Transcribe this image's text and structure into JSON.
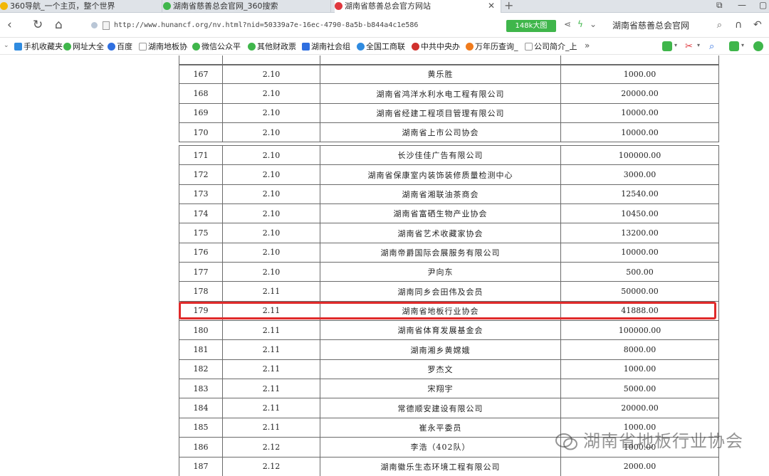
{
  "tabs": [
    {
      "title": "360导航_一个主页，整个世界",
      "icon_color": "#f2b705"
    },
    {
      "title": "湖南省慈善总会官网_360搜索",
      "icon_color": "#3fb64b"
    },
    {
      "title": "湖南省慈善总会官方网站",
      "icon_color": "#e0383e",
      "active": true
    }
  ],
  "address_bar": {
    "url": "http://www.hunancf.org/nv.html?nid=50339a7e-16ec-4790-8a5b-b844a4c1e586",
    "badge": "148k大图",
    "search_text": "湖南省慈善总会官网"
  },
  "bookmarks": [
    {
      "label": "手机收藏夹",
      "color": "#2f8be0"
    },
    {
      "label": "网址大全",
      "color": "#3fb64b"
    },
    {
      "label": "百度",
      "color": "#2f6fe0"
    },
    {
      "label": "湖南地板协",
      "color": "#bbbbbb"
    },
    {
      "label": "微信公众平",
      "color": "#3fb64b"
    },
    {
      "label": "其他财政票",
      "color": "#3fb64b"
    },
    {
      "label": "湖南社会组",
      "color": "#2f6fe0"
    },
    {
      "label": "全国工商联",
      "color": "#2f8be0"
    },
    {
      "label": "中共中央办",
      "color": "#d0312d"
    },
    {
      "label": "万年历查询_",
      "color": "#f07b1d"
    },
    {
      "label": "公司简介_上",
      "color": "#bbbbbb"
    }
  ],
  "table_top": {
    "rows": [
      {
        "no": "167",
        "date": "2.10",
        "donor": "黄乐胜",
        "amount": "1000.00"
      },
      {
        "no": "168",
        "date": "2.10",
        "donor": "湖南省鸿洋水利水电工程有限公司",
        "amount": "20000.00"
      },
      {
        "no": "169",
        "date": "2.10",
        "donor": "湖南省经建工程项目管理有限公司",
        "amount": "10000.00"
      },
      {
        "no": "170",
        "date": "2.10",
        "donor": "湖南省上市公司协会",
        "amount": "10000.00"
      }
    ]
  },
  "table_bottom": {
    "rows": [
      {
        "no": "171",
        "date": "2.10",
        "donor": "长沙佳佳广告有限公司",
        "amount": "100000.00"
      },
      {
        "no": "172",
        "date": "2.10",
        "donor": "湖南省保康室内装饰装修质量检测中心",
        "amount": "3000.00"
      },
      {
        "no": "173",
        "date": "2.10",
        "donor": "湖南省湘联油茶商会",
        "amount": "12540.00"
      },
      {
        "no": "174",
        "date": "2.10",
        "donor": "湖南省富硒生物产业协会",
        "amount": "10450.00"
      },
      {
        "no": "175",
        "date": "2.10",
        "donor": "湖南省艺术收藏家协会",
        "amount": "13200.00"
      },
      {
        "no": "176",
        "date": "2.10",
        "donor": "湖南帝爵国际会展服务有限公司",
        "amount": "10000.00"
      },
      {
        "no": "177",
        "date": "2.10",
        "donor": "尹向东",
        "amount": "500.00"
      },
      {
        "no": "178",
        "date": "2.11",
        "donor": "湖南同乡会田伟及会员",
        "amount": "50000.00"
      },
      {
        "no": "179",
        "date": "2.11",
        "donor": "湖南省地板行业协会",
        "amount": "41888.00",
        "highlighted": true
      },
      {
        "no": "180",
        "date": "2.11",
        "donor": "湖南省体育发展基金会",
        "amount": "100000.00"
      },
      {
        "no": "181",
        "date": "2.11",
        "donor": "湖南湘乡黄嫦娥",
        "amount": "8000.00"
      },
      {
        "no": "182",
        "date": "2.11",
        "donor": "罗杰文",
        "amount": "1000.00"
      },
      {
        "no": "183",
        "date": "2.11",
        "donor": "宋翔宇",
        "amount": "5000.00"
      },
      {
        "no": "184",
        "date": "2.11",
        "donor": "常德顺安建设有限公司",
        "amount": "20000.00"
      },
      {
        "no": "185",
        "date": "2.11",
        "donor": "崔永平委员",
        "amount": "1000.00"
      },
      {
        "no": "186",
        "date": "2.12",
        "donor": "李浩（402队）",
        "amount": "1000.00"
      },
      {
        "no": "187",
        "date": "2.12",
        "donor": "湖南徽乐生态环境工程有限公司",
        "amount": "2000.00"
      }
    ]
  },
  "watermark": "湖南省地板行业协会",
  "highlight_color": "#e02a2a"
}
